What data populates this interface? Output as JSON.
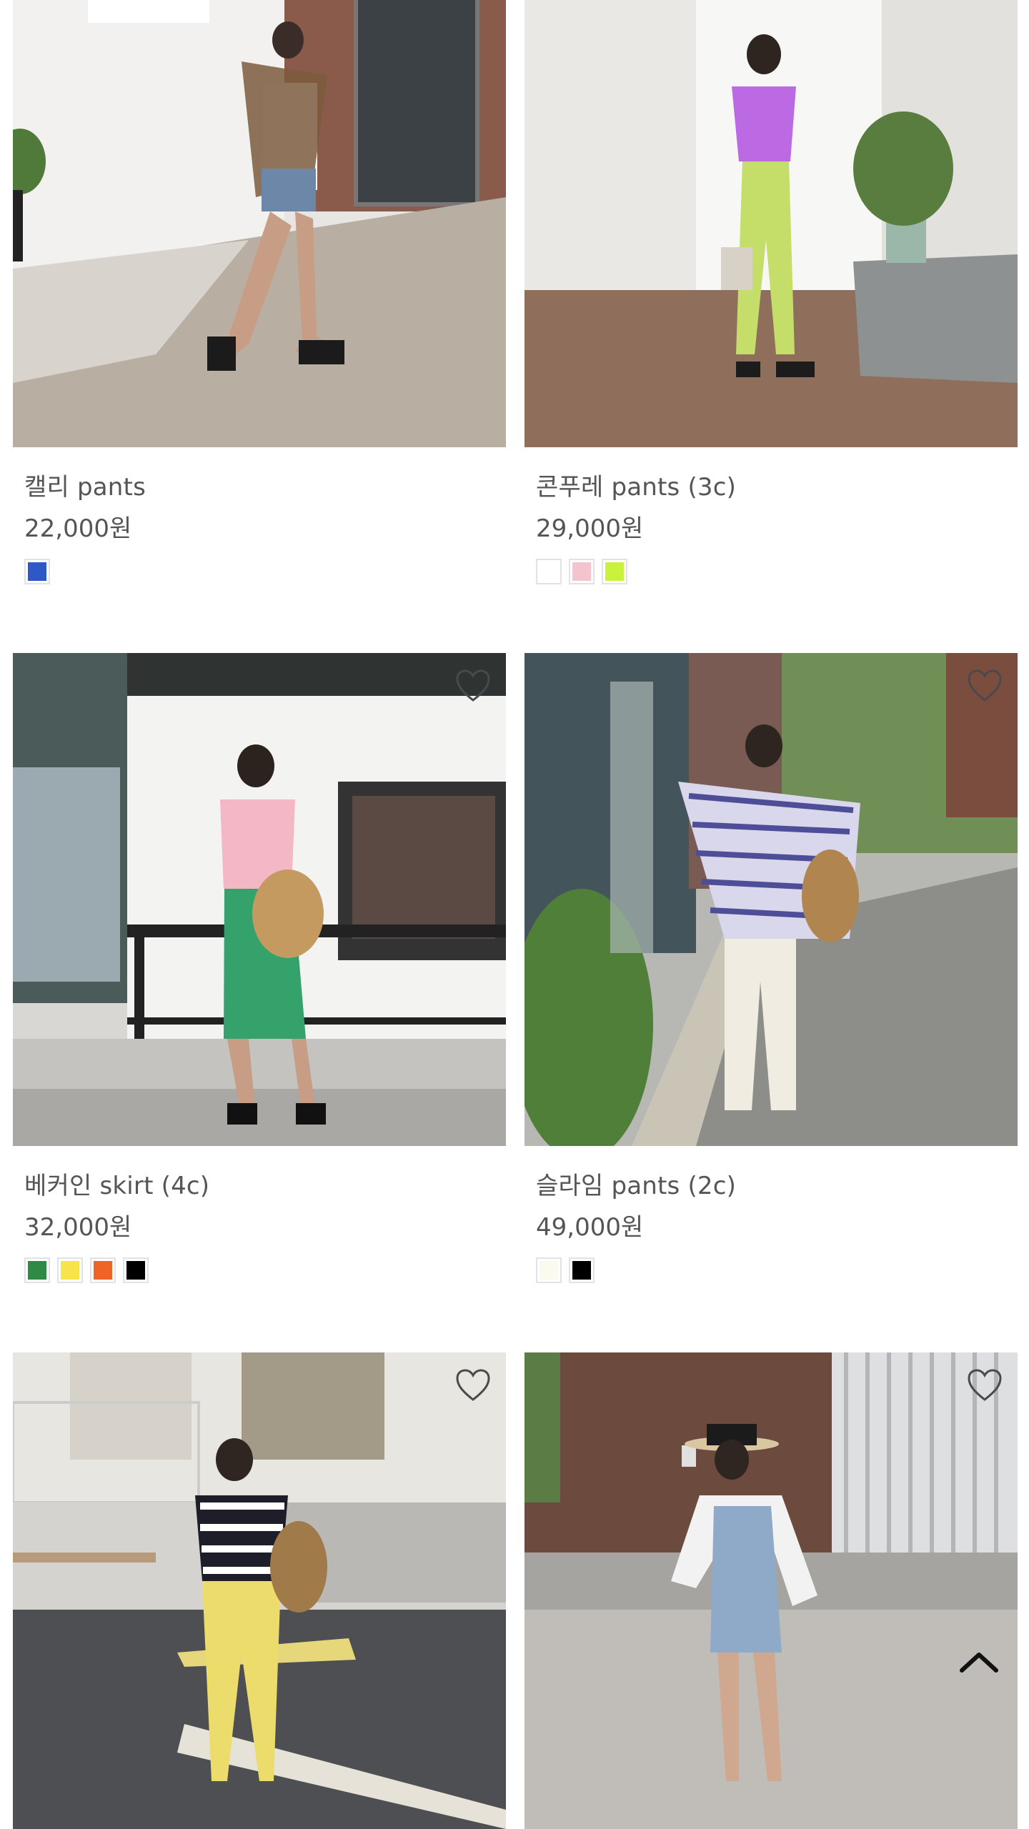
{
  "products": [
    {
      "name": "캘리 pants",
      "price": "22,000원",
      "colors": [
        "#2f58c7"
      ]
    },
    {
      "name": "콘푸레 pants (3c)",
      "price": "29,000원",
      "colors": [
        "#ffffff",
        "#f4c3cf",
        "#c9f23d"
      ]
    },
    {
      "name": "베커인 skirt (4c)",
      "price": "32,000원",
      "colors": [
        "#2e8a45",
        "#f7e44a",
        "#ee6326",
        "#000000"
      ]
    },
    {
      "name": "슬라임 pants (2c)",
      "price": "49,000원",
      "colors": [
        "#fbfaee",
        "#000000"
      ]
    },
    {
      "name": "",
      "price": "",
      "colors": []
    },
    {
      "name": "",
      "price": "",
      "colors": []
    }
  ],
  "icons": {
    "wishlist": "heart-icon",
    "scroll_top": "chevron-up-icon"
  }
}
